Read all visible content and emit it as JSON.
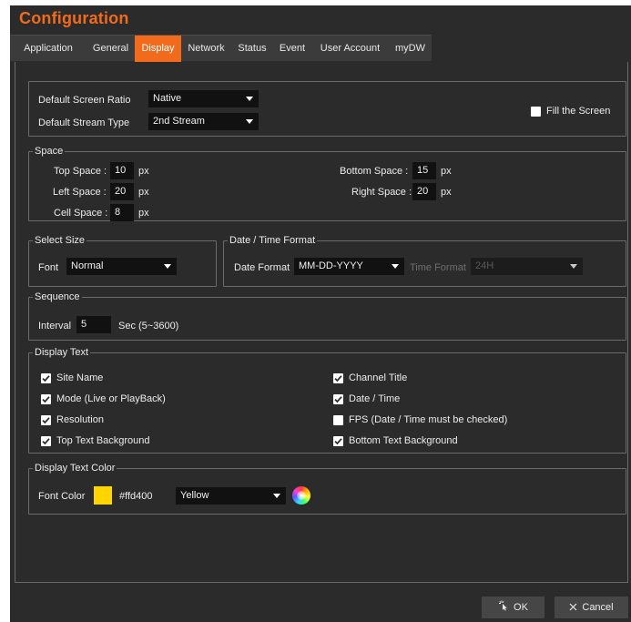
{
  "window": {
    "title": "Configuration"
  },
  "tabs": [
    "Application",
    "General",
    "Display",
    "Network",
    "Status",
    "Event",
    "User Account",
    "myDW"
  ],
  "active_tab": "Display",
  "screen": {
    "ratio_label": "Default Screen Ratio",
    "ratio_value": "Native",
    "stream_label": "Default Stream Type",
    "stream_value": "2nd Stream",
    "fill_label": "Fill the Screen",
    "fill_checked": false
  },
  "space": {
    "title": "Space",
    "top_label": "Top Space :",
    "top_value": "10",
    "left_label": "Left Space :",
    "left_value": "20",
    "cell_label": "Cell Space :",
    "cell_value": "8",
    "bottom_label": "Bottom Space :",
    "bottom_value": "15",
    "right_label": "Right Space :",
    "right_value": "20",
    "unit": "px"
  },
  "select_size": {
    "title": "Select Size",
    "font_label": "Font",
    "font_value": "Normal"
  },
  "datetime": {
    "title": "Date / Time Format",
    "date_label": "Date Format",
    "date_value": "MM-DD-YYYY",
    "time_label": "Time Format",
    "time_value": "24H"
  },
  "sequence": {
    "title": "Sequence",
    "interval_label": "Interval",
    "interval_value": "5",
    "unit": "Sec (5~3600)"
  },
  "display_text": {
    "title": "Display Text",
    "left": [
      {
        "label": "Site Name",
        "checked": true
      },
      {
        "label": "Mode (Live or PlayBack)",
        "checked": true
      },
      {
        "label": "Resolution",
        "checked": true
      },
      {
        "label": "Top Text Background",
        "checked": true
      }
    ],
    "right": [
      {
        "label": "Channel Title",
        "checked": true
      },
      {
        "label": "Date / Time",
        "checked": true
      },
      {
        "label": "FPS (Date / Time must be checked)",
        "checked": false
      },
      {
        "label": "Bottom Text Background",
        "checked": true
      }
    ]
  },
  "text_color": {
    "title": "Display Text Color",
    "font_color_label": "Font Color",
    "hex": "#ffd400",
    "color_name": "Yellow",
    "swatch_color": "#ffd400"
  },
  "buttons": {
    "ok": "OK",
    "cancel": "Cancel"
  },
  "theme": {
    "accent": "#f26b1d",
    "background": "#2b2b2b"
  }
}
